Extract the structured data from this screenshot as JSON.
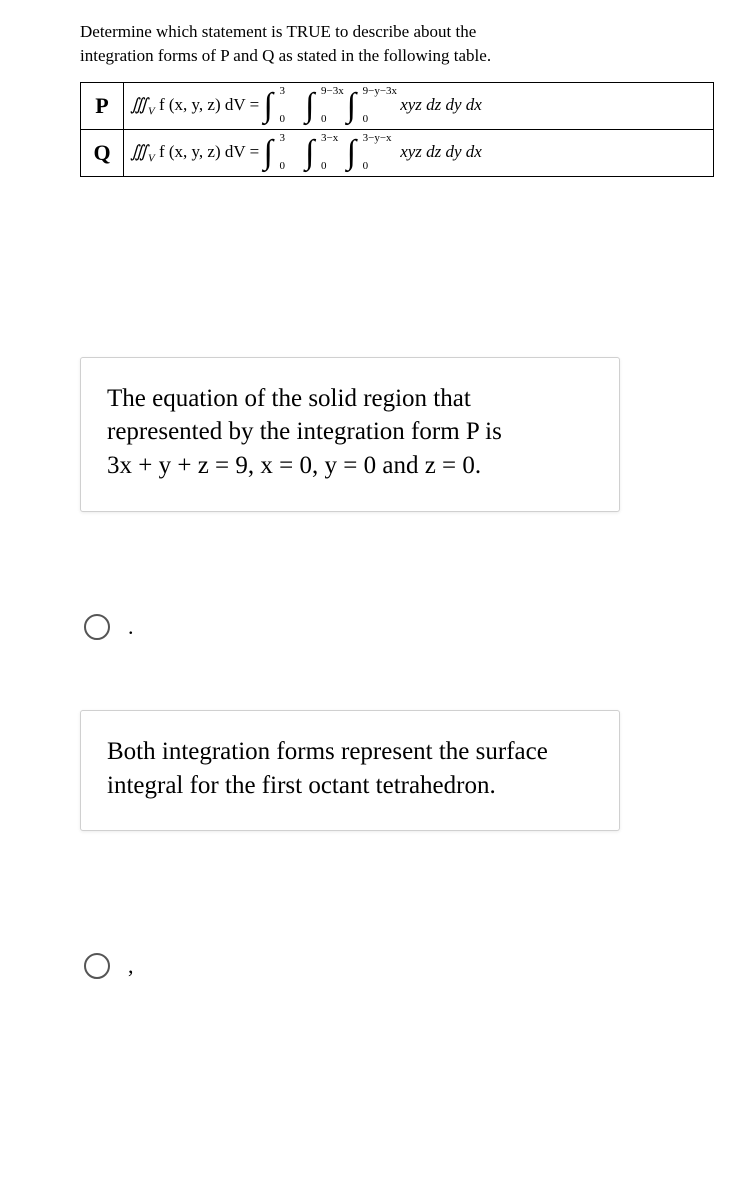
{
  "stem_line1": "Determine which statement is TRUE to describe about the",
  "stem_line2": "integration forms of P and Q as stated in the following table.",
  "table": {
    "rowP": {
      "label": "P",
      "lhs": "∭",
      "lhs_sub": "V",
      "lhs_rest": " f (x, y, z) dV  =",
      "int1": {
        "upper": "3",
        "lower": "0"
      },
      "int2": {
        "upper": "9−3x",
        "lower": "0"
      },
      "int3": {
        "upper": "9−y−3x",
        "lower": "0"
      },
      "integrand": "xyz dz dy dx"
    },
    "rowQ": {
      "label": "Q",
      "lhs": "∭",
      "lhs_sub": "V",
      "lhs_rest": " f (x, y, z) dV  =",
      "int1": {
        "upper": "3",
        "lower": "0"
      },
      "int2": {
        "upper": "3−x",
        "lower": "0"
      },
      "int3": {
        "upper": "3−y−x",
        "lower": "0"
      },
      "integrand": "xyz dz dy dx"
    }
  },
  "options": {
    "a": {
      "text_line1": "The equation of the solid region that",
      "text_line2": "represented by the integration form P is",
      "text_line3": "3x + y + z = 9, x = 0, y = 0 and z = 0.",
      "radio_label": "."
    },
    "b": {
      "text_line1": "Both integration forms represent the surface",
      "text_line2": "integral for the first octant tetrahedron.",
      "radio_label": ","
    }
  }
}
